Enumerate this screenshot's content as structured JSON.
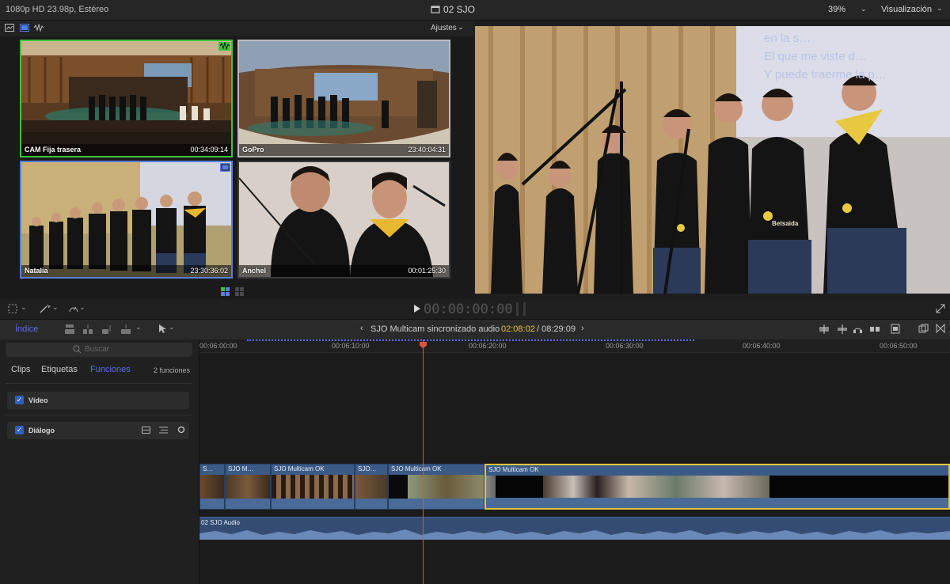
{
  "topbar": {
    "format": "1080p HD 23.98p, Estéreo",
    "project": "02 SJO",
    "zoom": "39%",
    "view_menu": "Visualización"
  },
  "angle_viewer": {
    "settings_label": "Ajustes",
    "angles": [
      {
        "name": "CAM Fija trasera",
        "timecode": "00:34:09:14"
      },
      {
        "name": "GoPro",
        "timecode": "23:40:04:31"
      },
      {
        "name": "Natalia",
        "timecode": "23:30:36:02"
      },
      {
        "name": "Anchel",
        "timecode": "00:01:25:30"
      }
    ]
  },
  "viewer": {
    "lyrics": [
      "en la s…",
      "El que me viste d…",
      "Y puede traerme la p…"
    ],
    "shirt_text": "Betsaida",
    "timecode": "00:00:00:00"
  },
  "timeline_bar": {
    "index_label": "Índice",
    "clip_title": "SJO Multicam sincronizado audio",
    "current_time": "02:08:02",
    "total_time": "/ 08:29:09"
  },
  "index_panel": {
    "search_placeholder": "Buscar",
    "tabs": [
      "Clips",
      "Etiquetas",
      "Funciones"
    ],
    "count": "2 funciones",
    "roles": [
      {
        "name": "Vídeo"
      },
      {
        "name": "Diálogo"
      }
    ]
  },
  "timeline": {
    "ruler": [
      "00:06:00:00",
      "00:06:10:00",
      "00:06:20:00",
      "00:06:30:00",
      "00:06:40:00",
      "00:06:50:00"
    ],
    "clips": [
      "S…",
      "SJO M…",
      "SJO Multicam OK",
      "SJO…",
      "SJO Multicam OK",
      "SJO Multicam OK"
    ],
    "audio_clip": "02 SJO Audio"
  },
  "colors": {
    "accent_blue": "#5a6ef0",
    "playhead": "#e0533a",
    "active_video_angle": "#3cc43c",
    "active_audio_angle": "#5a7ee0",
    "selected_clip": "#e6c53a",
    "clip_blue": "#3b5a86"
  }
}
